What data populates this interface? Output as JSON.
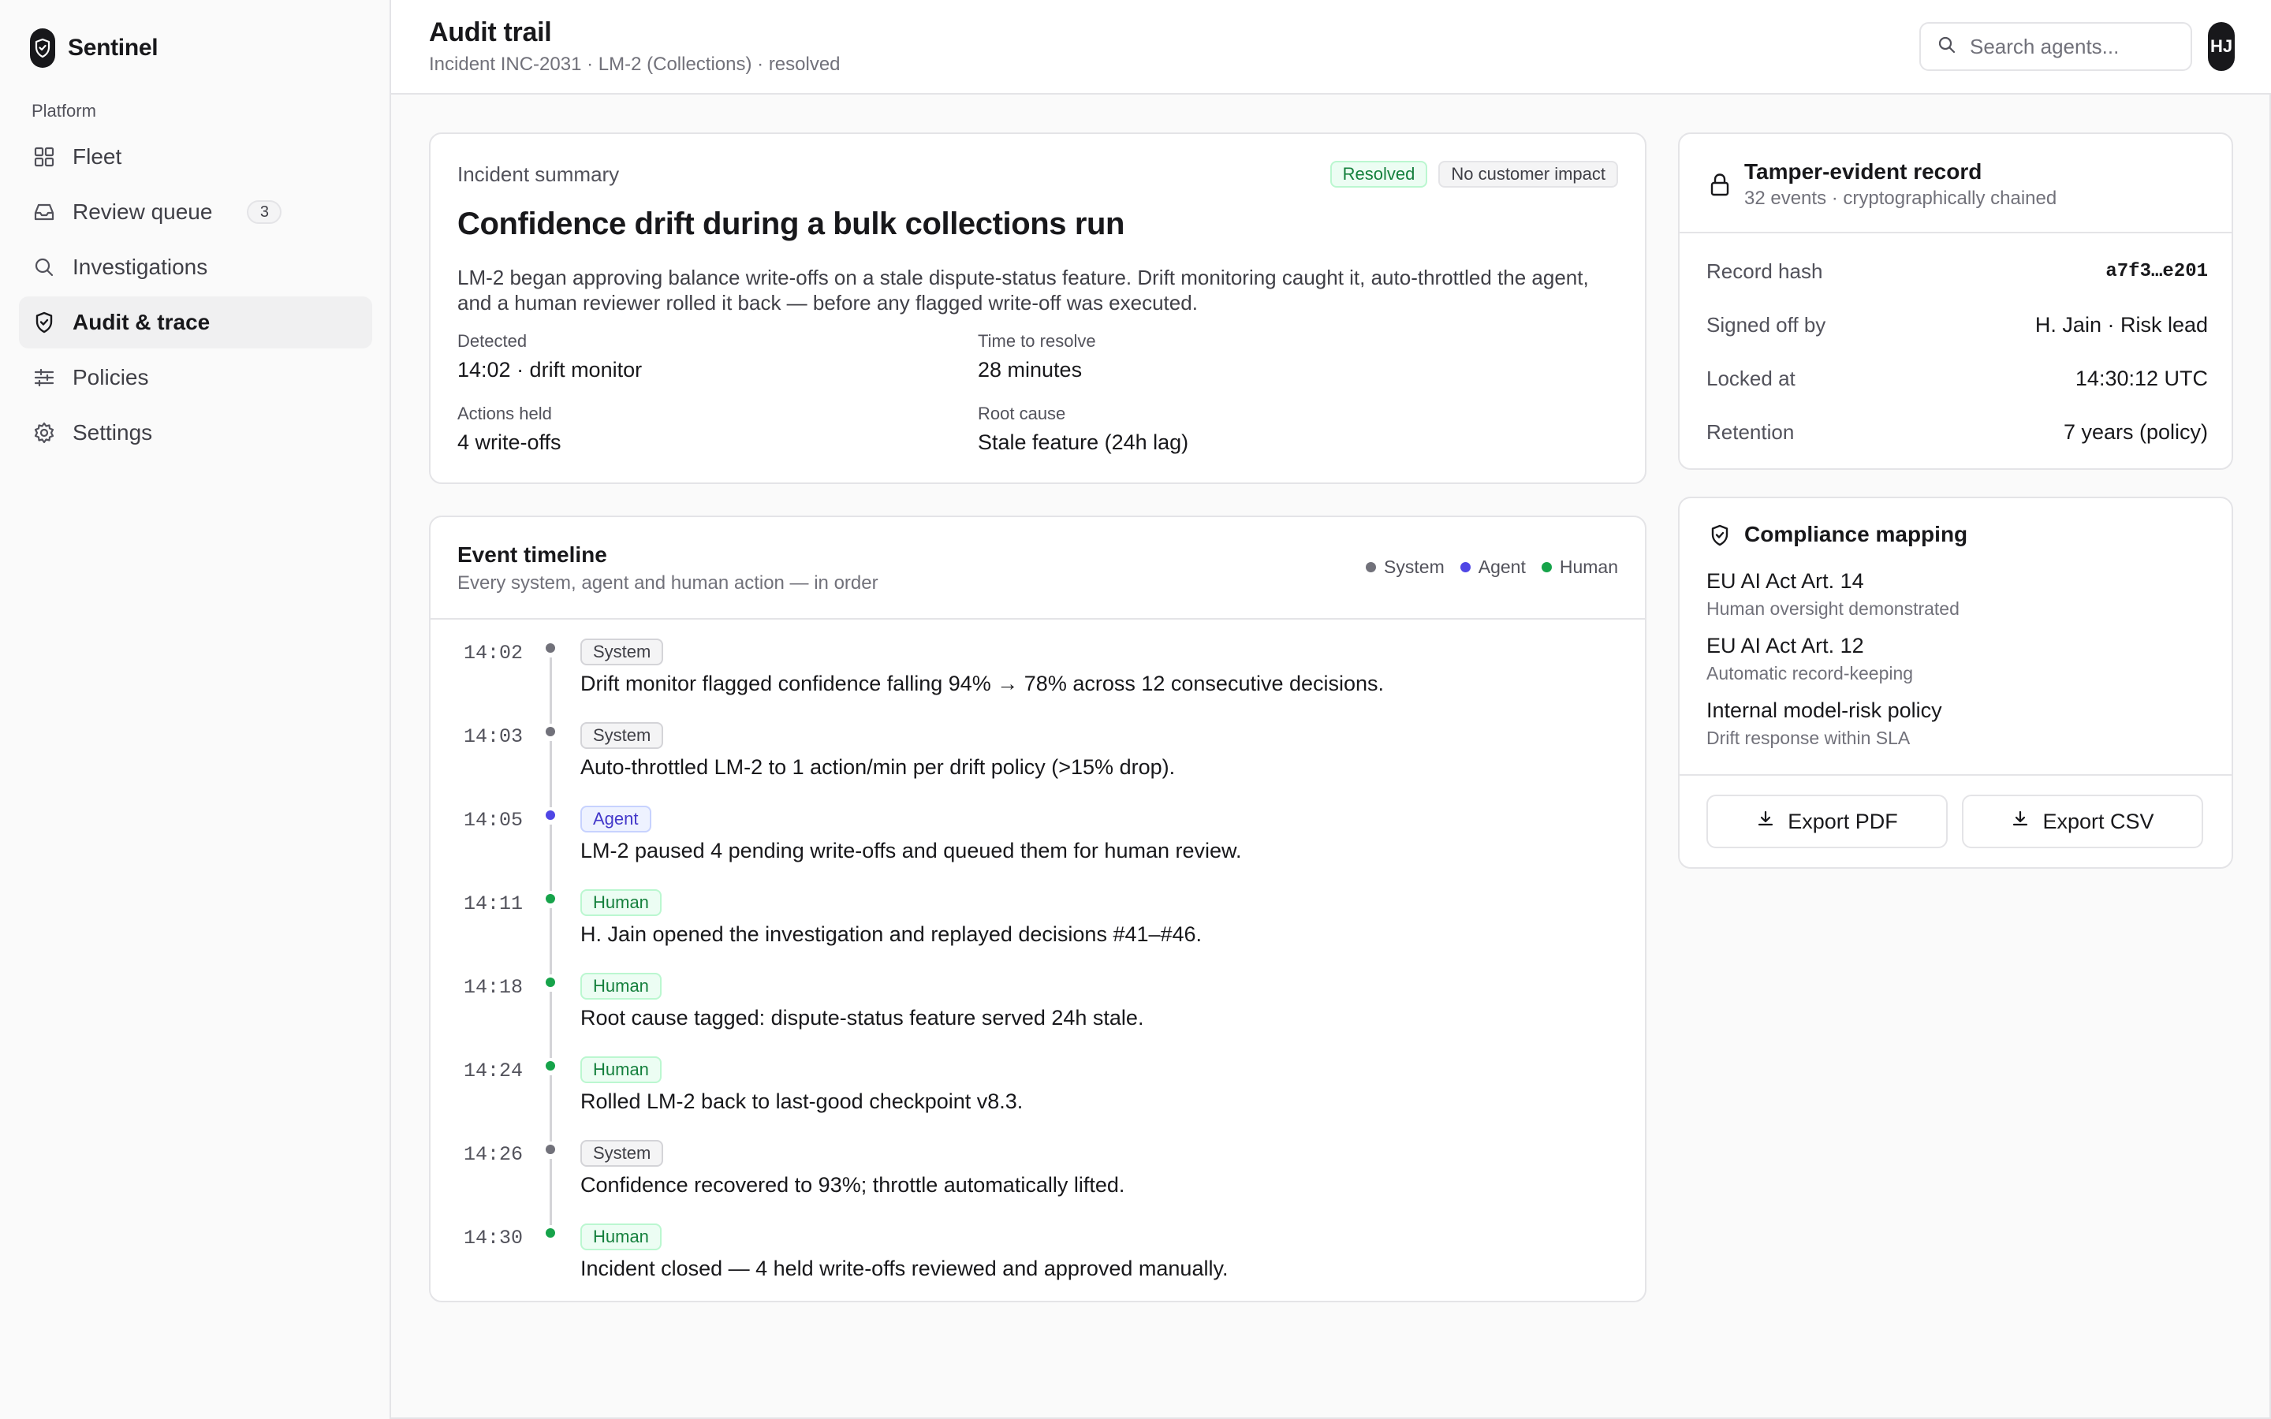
{
  "app": {
    "name": "Sentinel"
  },
  "sidebar": {
    "section": "Platform",
    "items": [
      {
        "label": "Fleet",
        "icon": "grid-icon"
      },
      {
        "label": "Review queue",
        "icon": "inbox-icon",
        "count": "3"
      },
      {
        "label": "Investigations",
        "icon": "search-icon"
      },
      {
        "label": "Audit & trace",
        "icon": "shield-icon",
        "active": true
      },
      {
        "label": "Policies",
        "icon": "sliders-icon"
      },
      {
        "label": "Settings",
        "icon": "gear-icon"
      }
    ]
  },
  "header": {
    "title": "Audit trail",
    "subtitle": "Incident INC-2031 · LM-2 (Collections) · resolved",
    "search_placeholder": "Search agents...",
    "avatar": "HJ"
  },
  "summary": {
    "label": "Incident summary",
    "badges": [
      "Resolved",
      "No customer impact"
    ],
    "title": "Confidence drift during a bulk collections run",
    "description": "LM-2 began approving balance write-offs on a stale dispute-status feature. Drift monitoring caught it, auto-throttled the agent, and a human reviewer rolled it back — before any flagged write-off was executed.",
    "facts": [
      {
        "key": "Detected",
        "value": "14:02 · drift monitor"
      },
      {
        "key": "Time to resolve",
        "value": "28 minutes"
      },
      {
        "key": "Actions held",
        "value": "4 write-offs"
      },
      {
        "key": "Root cause",
        "value": "Stale feature (24h lag)"
      }
    ]
  },
  "timeline": {
    "title": "Event timeline",
    "subtitle": "Every system, agent and human action — in order",
    "legend": [
      {
        "label": "System",
        "color": "#71717a"
      },
      {
        "label": "Agent",
        "color": "#4f46e5"
      },
      {
        "label": "Human",
        "color": "#16a34a"
      }
    ],
    "events": [
      {
        "time": "14:02",
        "type": "System",
        "text": "Drift monitor flagged confidence falling 94% → 78% across 12 consecutive decisions."
      },
      {
        "time": "14:03",
        "type": "System",
        "text": "Auto-throttled LM-2 to 1 action/min per drift policy (>15% drop)."
      },
      {
        "time": "14:05",
        "type": "Agent",
        "text": "LM-2 paused 4 pending write-offs and queued them for human review."
      },
      {
        "time": "14:11",
        "type": "Human",
        "text": "H. Jain opened the investigation and replayed decisions #41–#46."
      },
      {
        "time": "14:18",
        "type": "Human",
        "text": "Root cause tagged: dispute-status feature served 24h stale."
      },
      {
        "time": "14:24",
        "type": "Human",
        "text": "Rolled LM-2 back to last-good checkpoint v8.3."
      },
      {
        "time": "14:26",
        "type": "System",
        "text": "Confidence recovered to 93%; throttle automatically lifted."
      },
      {
        "time": "14:30",
        "type": "Human",
        "text": "Incident closed — 4 held write-offs reviewed and approved manually."
      }
    ]
  },
  "record": {
    "title": "Tamper-evident record",
    "subtitle": "32 events · cryptographically chained",
    "rows": [
      {
        "key": "Record hash",
        "value": "a7f3…e201"
      },
      {
        "key": "Signed off by",
        "value": "H. Jain · Risk lead"
      },
      {
        "key": "Locked at",
        "value": "14:30:12 UTC"
      },
      {
        "key": "Retention",
        "value": "7 years (policy)"
      }
    ]
  },
  "compliance": {
    "title": "Compliance mapping",
    "items": [
      {
        "key": "EU AI Act Art. 14",
        "value": "Human oversight demonstrated"
      },
      {
        "key": "EU AI Act Art. 12",
        "value": "Automatic record-keeping"
      },
      {
        "key": "Internal model-risk policy",
        "value": "Drift response within SLA"
      }
    ],
    "buttons": [
      "Export PDF",
      "Export CSV"
    ]
  }
}
